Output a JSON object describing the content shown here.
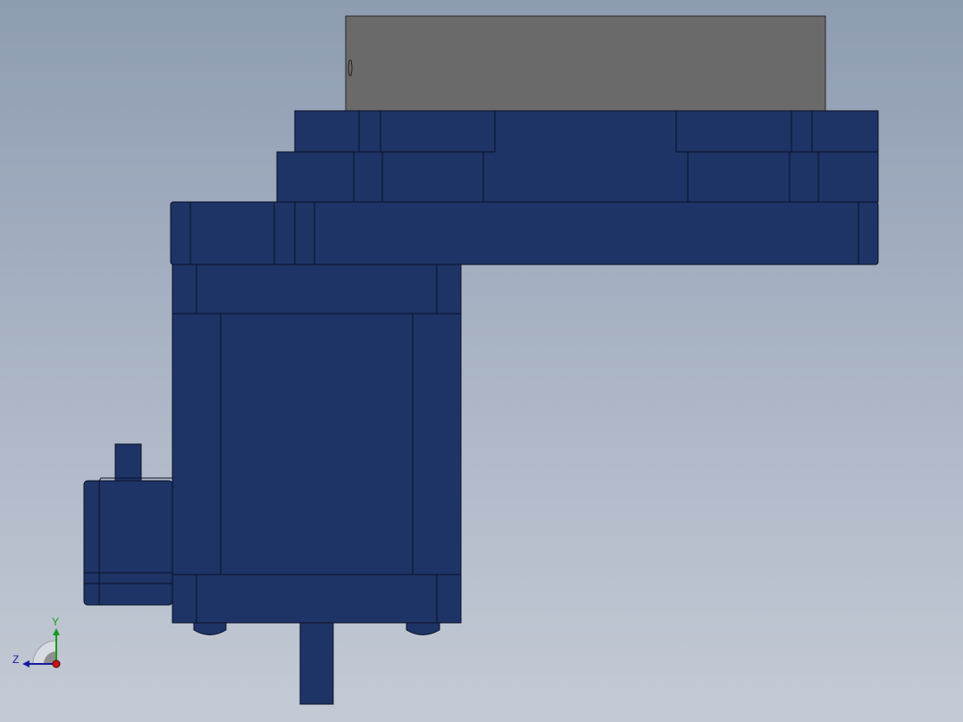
{
  "viewport": {
    "background_top": "#8e9cb1",
    "background_bottom": "#c4cad5"
  },
  "model": {
    "part_color": "#1e3466",
    "part_edge_color": "#0a1126",
    "cap_color": "#6a6a6a"
  },
  "triad": {
    "y_label": "Y",
    "z_label": "Z",
    "y_color": "#1a9a1a",
    "z_color": "#1a1aa0",
    "x_color": "#c01818"
  }
}
